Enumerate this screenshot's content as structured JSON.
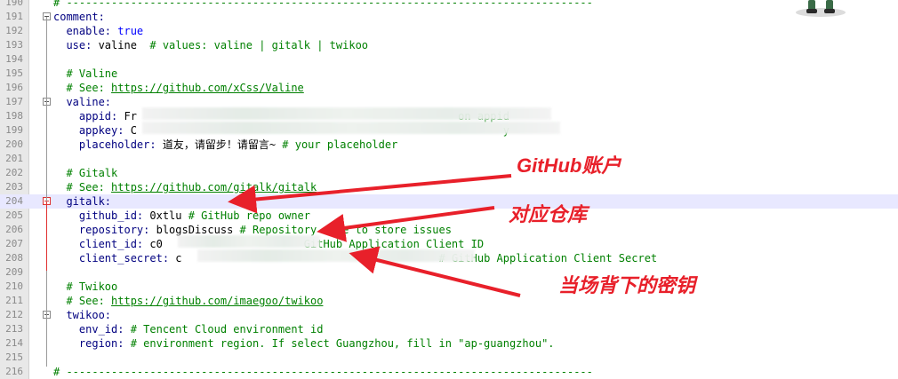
{
  "lines": [
    {
      "num": "190",
      "parts": [
        {
          "t": "# ----------------------------------------------------------------------------------",
          "c": "c"
        }
      ]
    },
    {
      "num": "191",
      "parts": [
        {
          "t": "comment:",
          "c": "k"
        }
      ]
    },
    {
      "num": "192",
      "parts": [
        {
          "t": "  enable: ",
          "c": "k"
        },
        {
          "t": "true",
          "c": "kw"
        }
      ]
    },
    {
      "num": "193",
      "parts": [
        {
          "t": "  use: ",
          "c": "k"
        },
        {
          "t": "valine  ",
          "c": "v"
        },
        {
          "t": "# values: valine | gitalk | twikoo",
          "c": "c"
        }
      ]
    },
    {
      "num": "194",
      "parts": []
    },
    {
      "num": "195",
      "parts": [
        {
          "t": "  # Valine",
          "c": "c"
        }
      ]
    },
    {
      "num": "196",
      "parts": [
        {
          "t": "  # See: ",
          "c": "c"
        },
        {
          "t": "https://github.com/xCss/Valine",
          "c": "u"
        }
      ]
    },
    {
      "num": "197",
      "parts": [
        {
          "t": "  valine:",
          "c": "k"
        }
      ]
    },
    {
      "num": "198",
      "parts": [
        {
          "t": "    appid: ",
          "c": "k"
        },
        {
          "t": "Fr",
          "c": "v"
        },
        {
          "t": "                                                  on appid",
          "c": "c"
        }
      ]
    },
    {
      "num": "199",
      "parts": [
        {
          "t": "    appkey: ",
          "c": "k"
        },
        {
          "t": "C",
          "c": "v"
        },
        {
          "t": "                                                         y",
          "c": "c"
        }
      ]
    },
    {
      "num": "200",
      "parts": [
        {
          "t": "    placeholder: ",
          "c": "k"
        },
        {
          "t": "道友，请留步！请留言~ ",
          "c": "v"
        },
        {
          "t": "# your placeholder",
          "c": "c"
        }
      ]
    },
    {
      "num": "201",
      "parts": []
    },
    {
      "num": "202",
      "parts": [
        {
          "t": "  # Gitalk",
          "c": "c"
        }
      ]
    },
    {
      "num": "203",
      "parts": [
        {
          "t": "  # See: ",
          "c": "c"
        },
        {
          "t": "https://github.com/gitalk/gitalk",
          "c": "u"
        }
      ]
    },
    {
      "num": "204",
      "parts": [
        {
          "t": "  gitalk:",
          "c": "k"
        }
      ]
    },
    {
      "num": "205",
      "parts": [
        {
          "t": "    github_id: ",
          "c": "k"
        },
        {
          "t": "0xtlu ",
          "c": "v"
        },
        {
          "t": "# GitHub repo owner",
          "c": "c"
        }
      ]
    },
    {
      "num": "206",
      "parts": [
        {
          "t": "    repository: ",
          "c": "k"
        },
        {
          "t": "blogsDiscuss ",
          "c": "v"
        },
        {
          "t": "# Repository name to store issues",
          "c": "c"
        }
      ]
    },
    {
      "num": "207",
      "parts": [
        {
          "t": "    client_id: ",
          "c": "k"
        },
        {
          "t": "c0",
          "c": "v"
        },
        {
          "t": "                      GitHub Application Client ID",
          "c": "c"
        }
      ]
    },
    {
      "num": "208",
      "parts": [
        {
          "t": "    client_secret: ",
          "c": "k"
        },
        {
          "t": "c",
          "c": "v"
        },
        {
          "t": "                                        # GitHub Application Client Secret",
          "c": "c"
        }
      ]
    },
    {
      "num": "209",
      "parts": []
    },
    {
      "num": "210",
      "parts": [
        {
          "t": "  # Twikoo",
          "c": "c"
        }
      ]
    },
    {
      "num": "211",
      "parts": [
        {
          "t": "  # See: ",
          "c": "c"
        },
        {
          "t": "https://github.com/imaegoo/twikoo",
          "c": "u"
        }
      ]
    },
    {
      "num": "212",
      "parts": [
        {
          "t": "  twikoo:",
          "c": "k"
        }
      ]
    },
    {
      "num": "213",
      "parts": [
        {
          "t": "    env_id: ",
          "c": "k"
        },
        {
          "t": "# Tencent Cloud environment id",
          "c": "c"
        }
      ]
    },
    {
      "num": "214",
      "parts": [
        {
          "t": "    region: ",
          "c": "k"
        },
        {
          "t": "# environment region. If select Guangzhou, fill in \"ap-guangzhou\".",
          "c": "c"
        }
      ]
    },
    {
      "num": "215",
      "parts": []
    },
    {
      "num": "216",
      "parts": [
        {
          "t": "# ----------------------------------------------------------------------------------",
          "c": "c"
        }
      ]
    }
  ],
  "annotations": {
    "github_account": "GitHub账户",
    "repo": "对应仓库",
    "secret": "当场背下的密钥"
  },
  "colors": {
    "arrow": "#e8202a",
    "comment": "#008000",
    "key": "#000080",
    "bool": "#0000ff"
  }
}
